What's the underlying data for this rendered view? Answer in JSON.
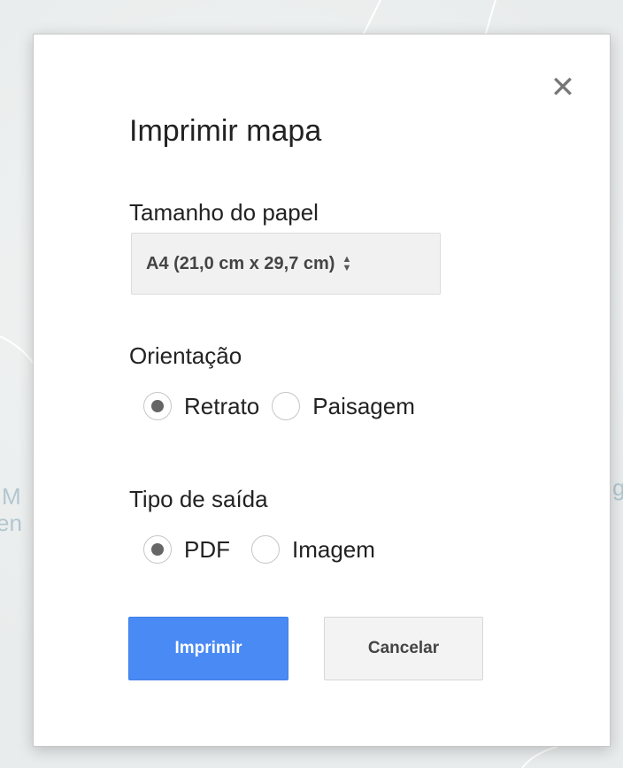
{
  "background": {
    "left_label_lines": [
      "M",
      "en"
    ],
    "right_label": "g"
  },
  "dialog": {
    "title": "Imprimir mapa",
    "close_glyph": "✕",
    "paper_size": {
      "label": "Tamanho do papel",
      "selected": "A4 (21,0 cm x 29,7 cm)"
    },
    "orientation": {
      "label": "Orientação",
      "options": [
        "Retrato",
        "Paisagem"
      ],
      "selected": "Retrato"
    },
    "output_type": {
      "label": "Tipo de saída",
      "options": [
        "PDF",
        "Imagem"
      ],
      "selected": "PDF"
    },
    "buttons": {
      "print": "Imprimir",
      "cancel": "Cancelar"
    }
  },
  "colors": {
    "primary_button": "#4a8af4",
    "radio_dot": "#666666"
  }
}
